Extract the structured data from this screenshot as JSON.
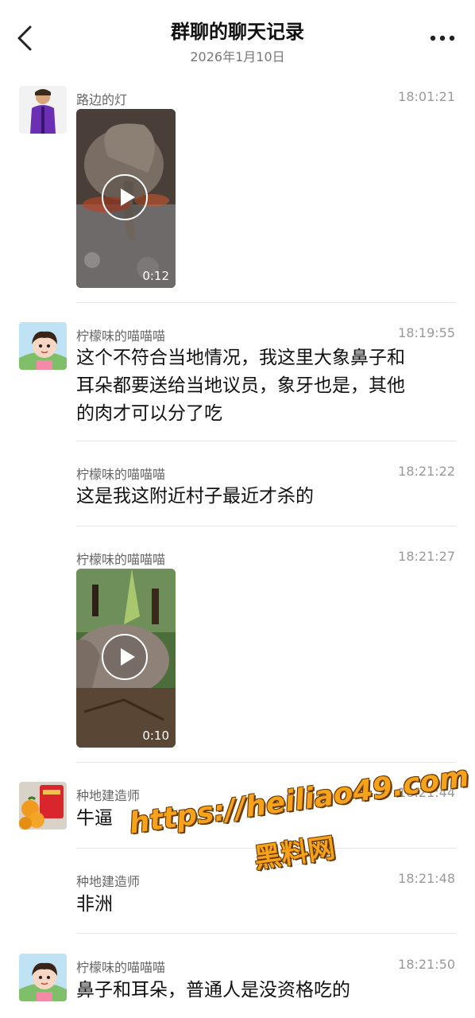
{
  "header": {
    "title": "群聊的聊天记录",
    "date": "2026年1月10日"
  },
  "messages": [
    {
      "sender": "路边的灯",
      "time": "18:01:21",
      "type": "video",
      "duration": "0:12",
      "avatar": "purple-jacket-avatar"
    },
    {
      "sender": "柠檬味的喵喵喵",
      "time": "18:19:55",
      "type": "text",
      "lines": [
        "这个不符合当地情况，我这里大象鼻子和",
        "耳朵都要送给当地议员，象牙也是，其他",
        "的肉才可以分了吃"
      ],
      "avatar": "cartoon-girl-avatar"
    },
    {
      "sender": "柠檬味的喵喵喵",
      "time": "18:21:22",
      "type": "text",
      "lines": [
        "这是我这附近村子最近才杀的"
      ]
    },
    {
      "sender": "柠檬味的喵喵喵",
      "time": "18:21:27",
      "type": "video",
      "duration": "0:10"
    },
    {
      "sender": "种地建造师",
      "time": "18:21:44",
      "type": "text",
      "lines": [
        "牛逼"
      ],
      "avatar": "oranges-redpacket-avatar"
    },
    {
      "sender": "种地建造师",
      "time": "18:21:48",
      "type": "text",
      "lines": [
        "非洲"
      ]
    },
    {
      "sender": "柠檬味的喵喵喵",
      "time": "18:21:50",
      "type": "text",
      "lines": [
        "鼻子和耳朵，普通人是没资格吃的"
      ],
      "avatar": "cartoon-girl-avatar"
    }
  ],
  "watermark": {
    "url": "https://heiliao49.com",
    "name": "黑料网"
  },
  "colors": {
    "accent_watermark": "#f7a21b",
    "text": "#111111",
    "meta": "#999999"
  }
}
